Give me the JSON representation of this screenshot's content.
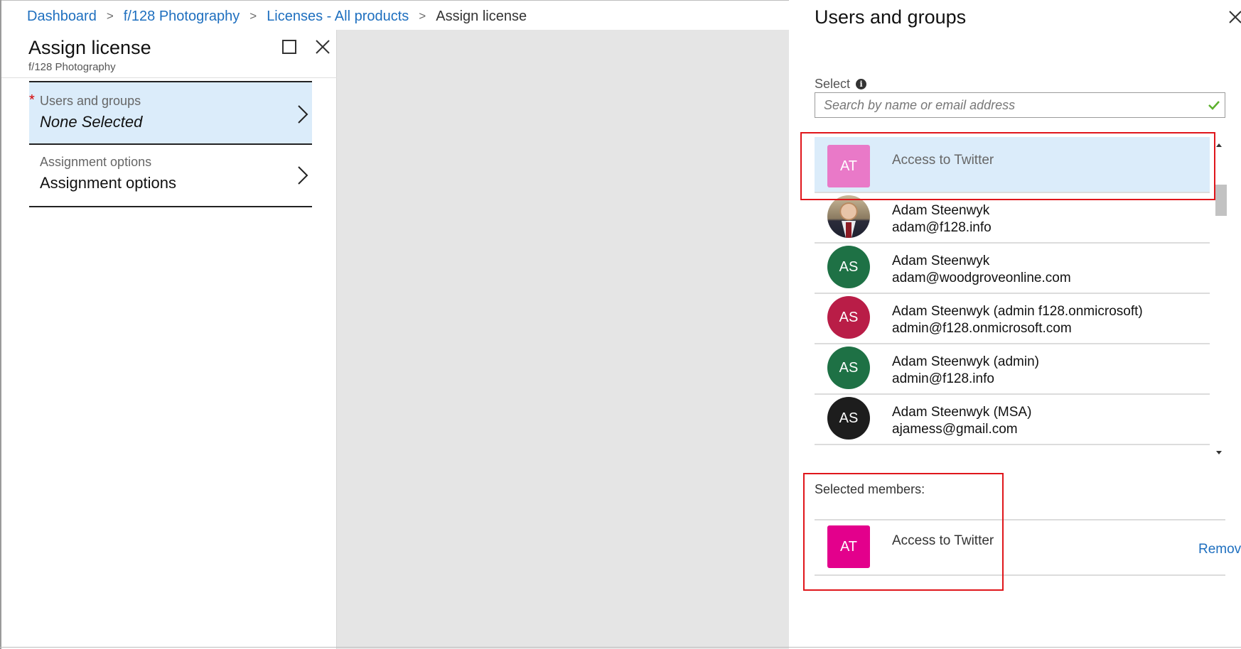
{
  "breadcrumb": {
    "items": [
      "Dashboard",
      "f/128 Photography",
      "Licenses - All products"
    ],
    "current": "Assign license",
    "separator": ">"
  },
  "left_blade": {
    "title": "Assign license",
    "subtitle": "f/128 Photography",
    "maximize_icon": "square-icon",
    "close_icon": "close-icon",
    "menu": [
      {
        "required_mark": "*",
        "label": "Users and groups",
        "value": "None Selected",
        "selected": true
      },
      {
        "label": "Assignment options",
        "value": "Assignment options",
        "selected": false
      }
    ]
  },
  "right_panel": {
    "title": "Users and groups",
    "select_label": "Select",
    "search_placeholder": "Search by name or email address",
    "list": [
      {
        "initials": "AT",
        "name": "Access to Twitter",
        "email": "",
        "avatar_color": "#e979c8",
        "avatar_shape": "square",
        "highlighted": true
      },
      {
        "initials": "",
        "name": "Adam Steenwyk",
        "email": "adam@f128.info",
        "avatar_color": "photo",
        "avatar_shape": "photo",
        "highlighted": false
      },
      {
        "initials": "AS",
        "name": "Adam Steenwyk",
        "email": "adam@woodgroveonline.com",
        "avatar_color": "#1e7145",
        "avatar_shape": "round",
        "highlighted": false
      },
      {
        "initials": "AS",
        "name": "Adam Steenwyk (admin f128.onmicrosoft)",
        "email": "admin@f128.onmicrosoft.com",
        "avatar_color": "#b91d47",
        "avatar_shape": "round",
        "highlighted": false
      },
      {
        "initials": "AS",
        "name": "Adam Steenwyk (admin)",
        "email": "admin@f128.info",
        "avatar_color": "#1e7145",
        "avatar_shape": "round",
        "highlighted": false
      },
      {
        "initials": "AS",
        "name": "Adam Steenwyk (MSA)",
        "email": "ajamess@gmail.com",
        "avatar_color": "#1d1d1d",
        "avatar_shape": "round",
        "highlighted": false
      }
    ],
    "selected_members_label": "Selected members:",
    "selected_members": [
      {
        "initials": "AT",
        "name": "Access to Twitter",
        "avatar_color": "#e3008c",
        "remove_label": "Remove"
      }
    ]
  },
  "colors": {
    "link": "#1e6fbf",
    "selected_bg": "#dbecfa",
    "highlight_box": "#e0161b",
    "check": "#5cb02c"
  }
}
